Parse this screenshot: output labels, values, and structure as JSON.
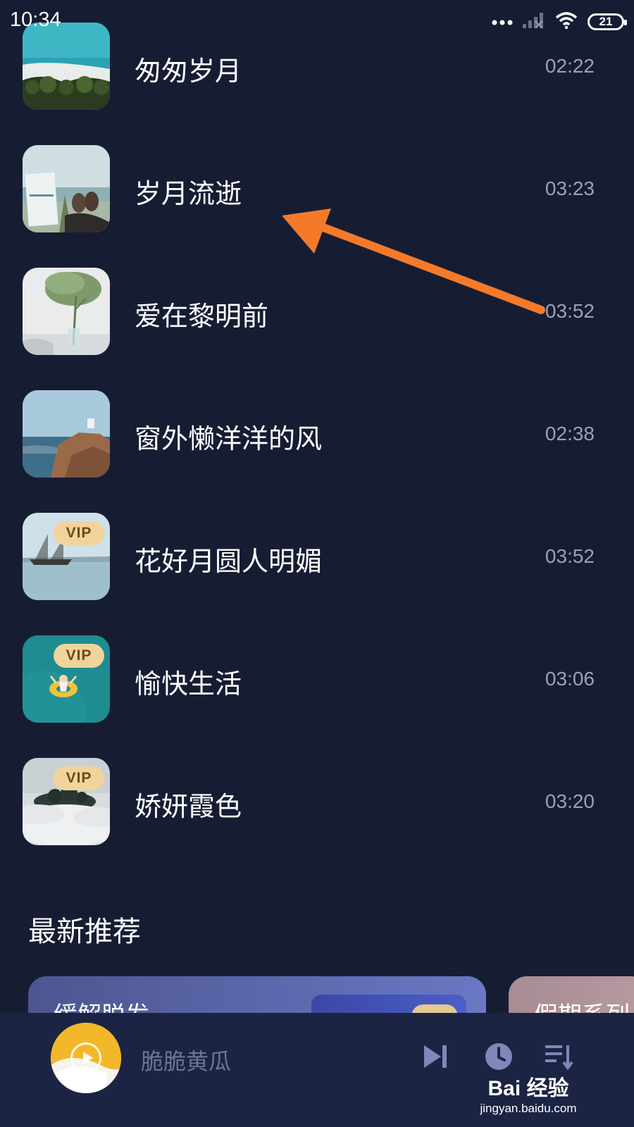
{
  "status_bar": {
    "time": "10:34",
    "battery": "21",
    "icons": [
      "more-dots-icon",
      "signal-icon",
      "wifi-icon",
      "battery-icon"
    ]
  },
  "songs": [
    {
      "title": "匆匆岁月",
      "duration": "02:22",
      "vip": false,
      "thumb": "beach-aerial"
    },
    {
      "title": "岁月流逝",
      "duration": "03:23",
      "vip": false,
      "thumb": "feet-by-sea"
    },
    {
      "title": "爱在黎明前",
      "duration": "03:52",
      "vip": false,
      "thumb": "plant-in-vase"
    },
    {
      "title": "窗外懒洋洋的风",
      "duration": "02:38",
      "vip": false,
      "thumb": "cliff-coast"
    },
    {
      "title": "花好月圆人明媚",
      "duration": "03:52",
      "vip": true,
      "vip_label": "VIP",
      "thumb": "sailboat"
    },
    {
      "title": "愉快生活",
      "duration": "03:06",
      "vip": true,
      "vip_label": "VIP",
      "thumb": "swimmer-ring"
    },
    {
      "title": "娇妍霞色",
      "duration": "03:20",
      "vip": true,
      "vip_label": "VIP",
      "thumb": "island-in-clouds"
    }
  ],
  "section": {
    "title": "最新推荐"
  },
  "recommend": {
    "card1_title": "缓解脱发",
    "card2_title": "假期系列"
  },
  "player": {
    "title": "脆脆黄瓜",
    "controls": [
      "next-icon",
      "timer-icon",
      "playlist-icon"
    ]
  },
  "watermark": {
    "logo": "Bai 经验",
    "url": "jingyan.baidu.com"
  },
  "colors": {
    "background": "#161d33",
    "player_background": "#1c2444",
    "vip_badge": "#f1d49a",
    "arrow": "#f47a2a",
    "duration_text": "#9aa1b8"
  }
}
